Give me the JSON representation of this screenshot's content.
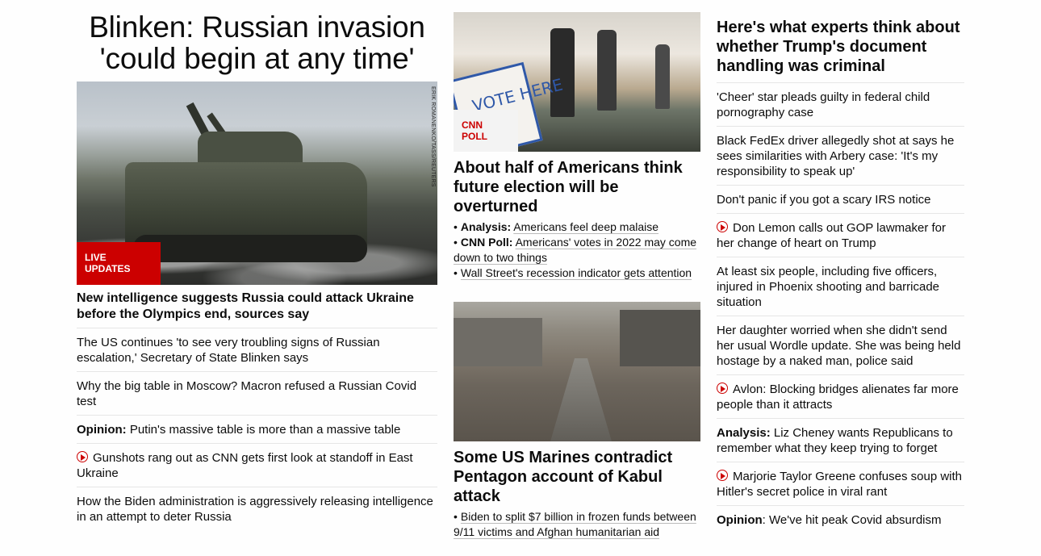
{
  "left": {
    "hero_title": "Blinken: Russian invasion 'could begin at any time'",
    "image_credit": "ERIK ROMANENKO/TASS/REUTERS",
    "badge": "LIVE UPDATES",
    "main_headline": "New intelligence suggests Russia could attack Ukraine before the Olympics end, sources say",
    "items": [
      {
        "prefix": "",
        "text": "The US continues 'to see very troubling signs of Russian escalation,' Secretary of State Blinken says",
        "video": false
      },
      {
        "prefix": "",
        "text": "Why the big table in Moscow? Macron refused a Russian Covid test",
        "video": false
      },
      {
        "prefix": "Opinion:",
        "text": " Putin's massive table is more than a massive table",
        "video": false
      },
      {
        "prefix": "",
        "text": "Gunshots rang out as CNN gets first look at standoff in East Ukraine",
        "video": true
      },
      {
        "prefix": "",
        "text": "How the Biden administration is aggressively releasing intelligence in an attempt to deter Russia",
        "video": false
      }
    ]
  },
  "middle": {
    "poll_badge": "CNN POLL",
    "poll_headline": "About half of Americans think future election will be overturned",
    "vote_sign": "VOTE HERE",
    "poll_bullets": [
      {
        "label": "Analysis:",
        "text": "Americans feel deep malaise"
      },
      {
        "label": "CNN Poll:",
        "text": "Americans' votes in 2022 may come down to two things"
      },
      {
        "label": "",
        "text": "Wall Street's recession indicator gets attention"
      }
    ],
    "kabul_headline": "Some US Marines contradict Pentagon account of Kabul attack",
    "kabul_bullets": [
      {
        "label": "",
        "text": "Biden to split $7 billion in frozen funds between 9/11 victims and Afghan humanitarian aid"
      }
    ]
  },
  "right": {
    "top_headline": "Here's what experts think about whether Trump's document handling was criminal",
    "items": [
      {
        "prefix": "",
        "text": "'Cheer' star pleads guilty in federal child pornography case",
        "video": false
      },
      {
        "prefix": "",
        "text": "Black FedEx driver allegedly shot at says he sees similarities with Arbery case: 'It's my responsibility to speak up'",
        "video": false
      },
      {
        "prefix": "",
        "text": "Don't panic if you got a scary IRS notice",
        "video": false
      },
      {
        "prefix": "",
        "text": "Don Lemon calls out GOP lawmaker for her change of heart on Trump",
        "video": true
      },
      {
        "prefix": "",
        "text": "At least six people, including five officers, injured in Phoenix shooting and barricade situation",
        "video": false
      },
      {
        "prefix": "",
        "text": "Her daughter worried when she didn't send her usual Wordle update. She was being held hostage by a naked man, police said",
        "video": false
      },
      {
        "prefix": "",
        "text": "Avlon: Blocking bridges alienates far more people than it attracts",
        "video": true
      },
      {
        "prefix": "Analysis:",
        "text": " Liz Cheney wants Republicans to remember what they keep trying to forget",
        "video": false
      },
      {
        "prefix": "",
        "text": "Marjorie Taylor Greene confuses soup with Hitler's secret police in viral rant",
        "video": true
      },
      {
        "prefix": "Opinion",
        "text": ": We've hit peak Covid absurdism",
        "video": false
      }
    ]
  },
  "colors": {
    "accent": "#cc0000",
    "text": "#0c0c0c",
    "divider": "#e6e6e6"
  },
  "icons": {
    "video": "play-circle-icon"
  }
}
